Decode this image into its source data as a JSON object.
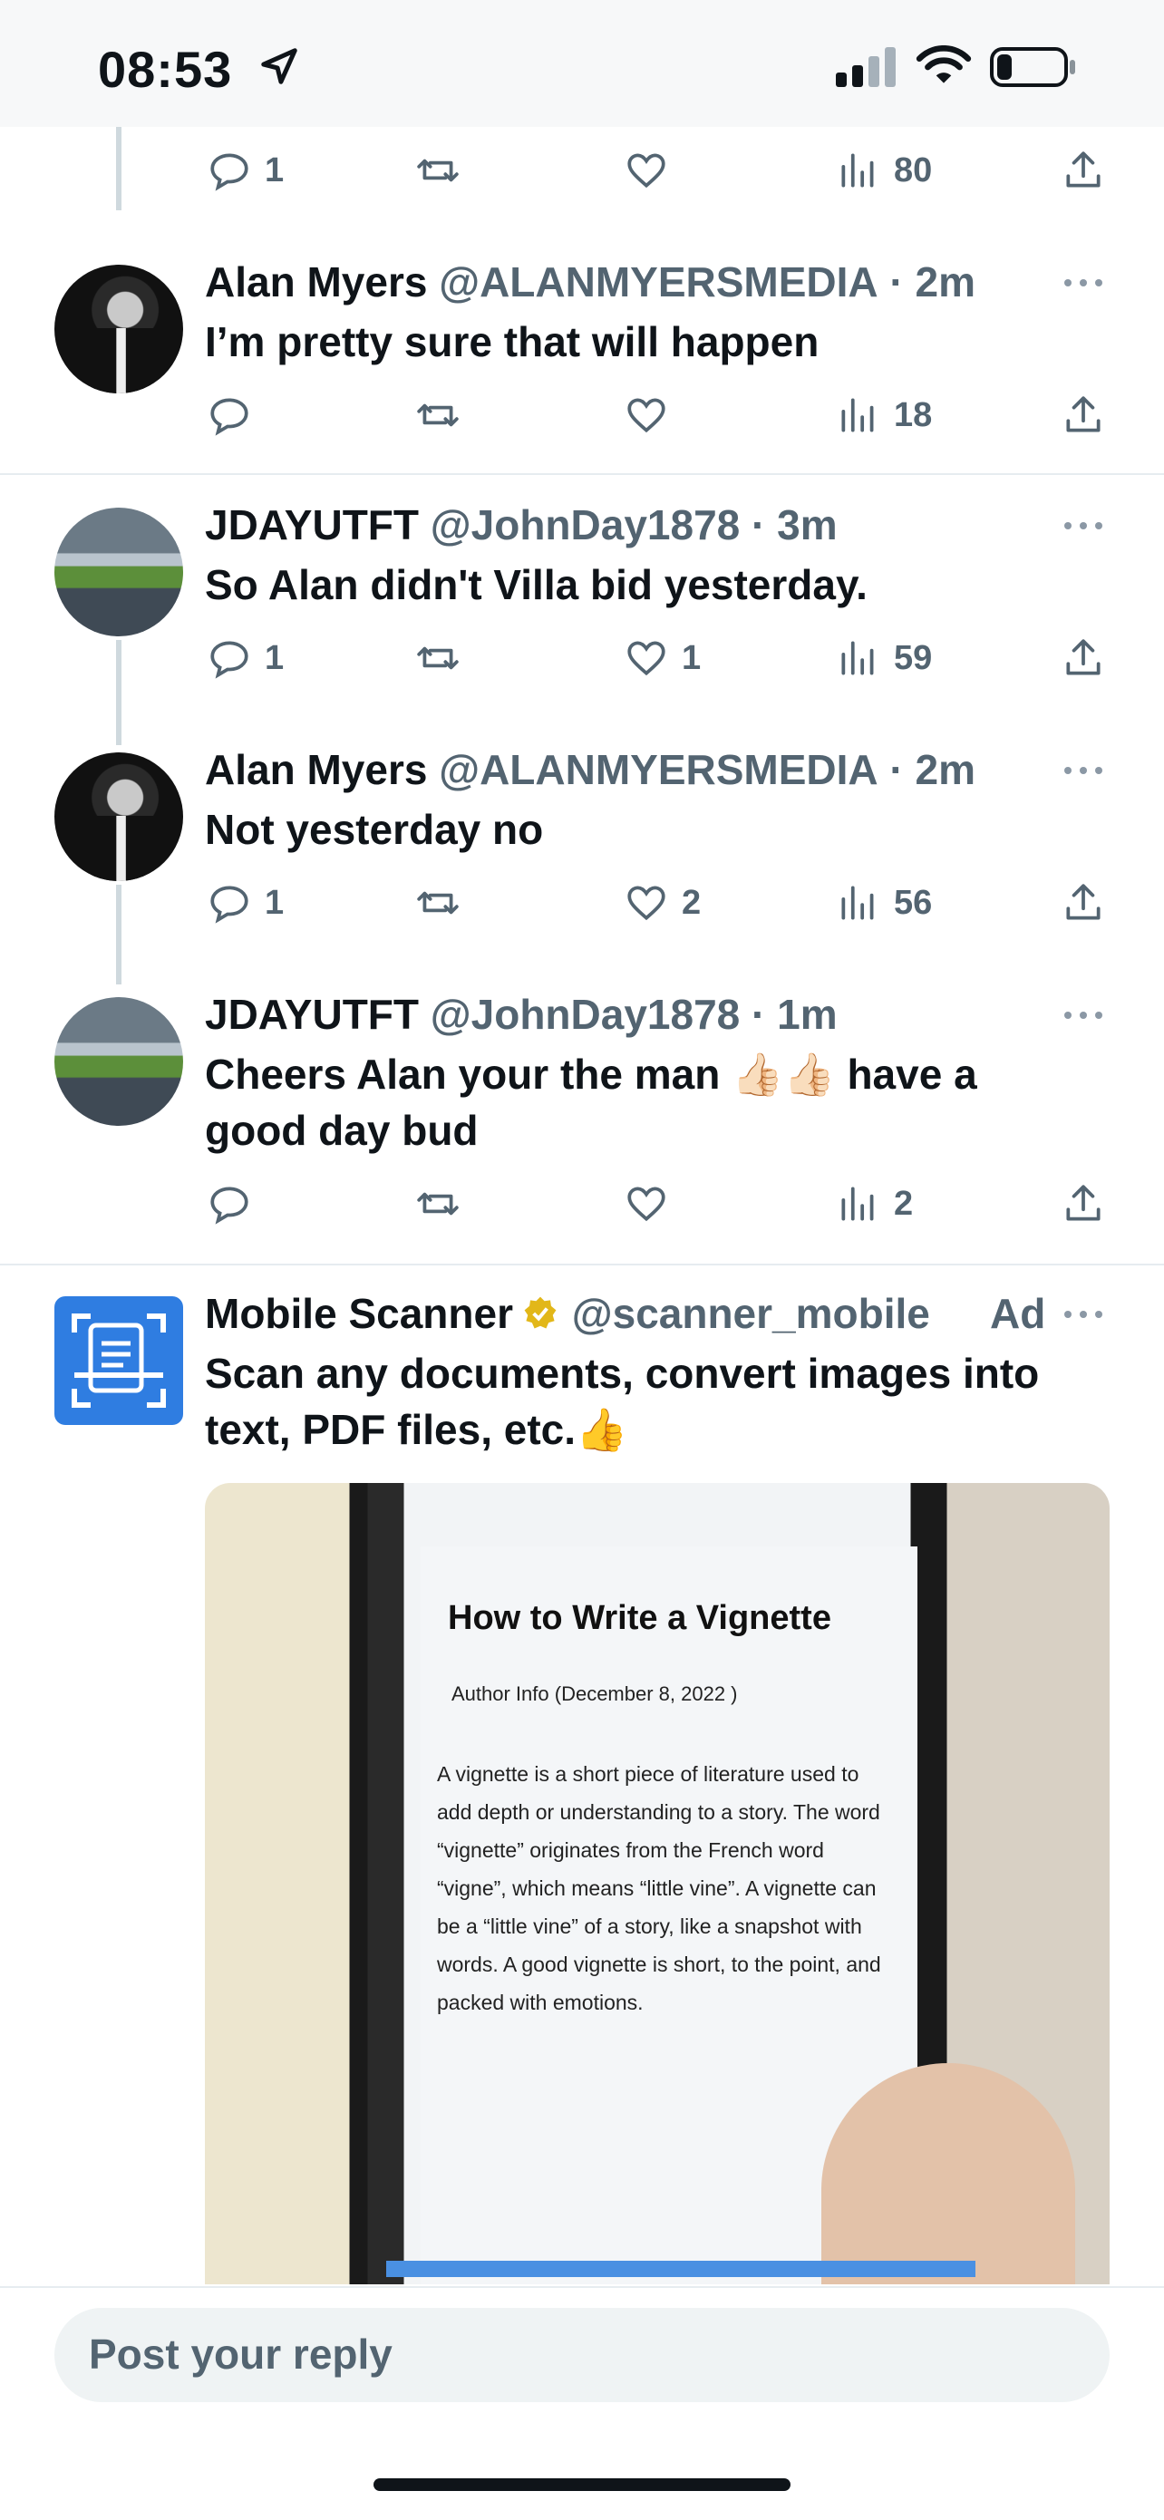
{
  "status_bar": {
    "time": "08:53"
  },
  "first_row_actions": {
    "replies": "1",
    "retweets": "",
    "likes": "",
    "views": "80"
  },
  "tweets": [
    {
      "name": "Alan Myers",
      "handle": "@ALANMYERSMEDIA",
      "time": "· 2m",
      "text": "I’m pretty sure that will happen",
      "replies": "",
      "retweets": "",
      "likes": "",
      "views": "18"
    },
    {
      "name": "JDAYUTFT",
      "handle": "@JohnDay1878",
      "time": "· 3m",
      "text": "So Alan didn't Villa bid yesterday.",
      "replies": "1",
      "retweets": "",
      "likes": "1",
      "views": "59"
    },
    {
      "name": "Alan Myers",
      "handle": "@ALANMYERSMEDIA",
      "time": "· 2m",
      "text": "Not yesterday no",
      "replies": "1",
      "retweets": "",
      "likes": "2",
      "views": "56"
    },
    {
      "name": "JDAYUTFT",
      "handle": "@JohnDay1878",
      "time": "· 1m",
      "text_line1": "Cheers Alan your the man 👍🏻👍🏻 have a",
      "text_line2": "good day bud",
      "replies": "",
      "retweets": "",
      "likes": "",
      "views": "2"
    }
  ],
  "ad": {
    "name": "Mobile Scanner",
    "handle": "@scanner_mobile",
    "label": "Ad",
    "text_line1": "Scan any documents, convert images into",
    "text_line2": "text, PDF files, etc.👍",
    "media": {
      "doc_title": "How to Write a Vignette",
      "doc_meta": "Author Info   (December 8, 2022 )",
      "doc_body": "A vignette is a short piece of literature used to add depth or understanding to a story. The word “vignette” originates from the French word “vigne”, which means “little vine”. A vignette can be a “little vine” of a story, like a snapshot with words. A good vignette is short, to the point, and packed with emotions."
    }
  },
  "reply": {
    "placeholder": "Post your reply"
  }
}
